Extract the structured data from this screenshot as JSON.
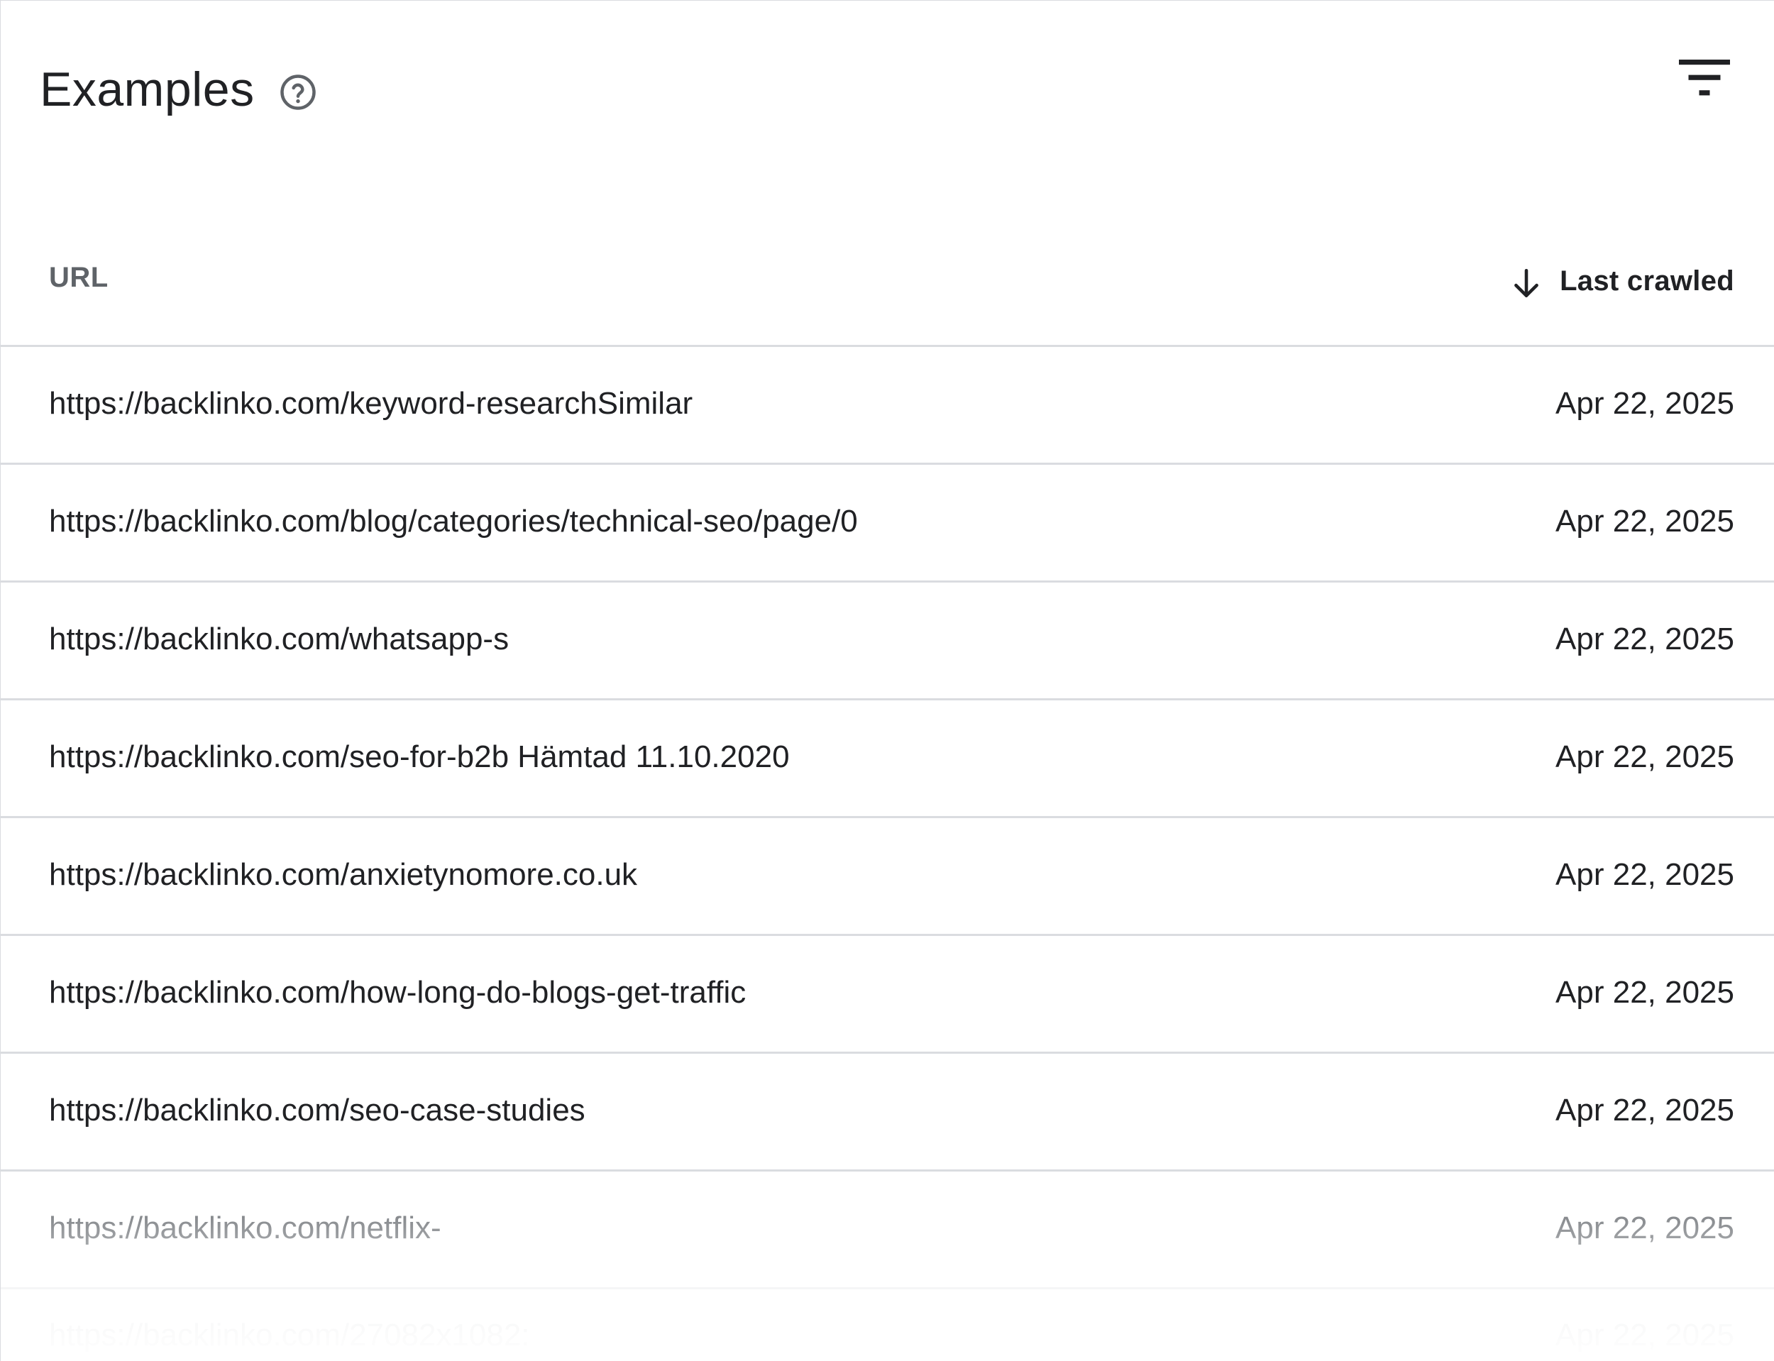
{
  "header": {
    "title": "Examples",
    "help_icon": "help-circle-icon",
    "filter_icon": "filter-icon"
  },
  "table": {
    "columns": {
      "url": "URL",
      "last_crawled": "Last crawled",
      "sort_icon": "arrow-down-icon"
    },
    "rows": [
      {
        "url": "https://backlinko.com/keyword-researchSimilar",
        "date": "Apr 22, 2025"
      },
      {
        "url": "https://backlinko.com/blog/categories/technical-seo/page/0",
        "date": "Apr 22, 2025"
      },
      {
        "url": "https://backlinko.com/whatsapp-s",
        "date": "Apr 22, 2025"
      },
      {
        "url": "https://backlinko.com/seo-for-b2b Hämtad 11.10.2020",
        "date": "Apr 22, 2025"
      },
      {
        "url": "https://backlinko.com/anxietynomore.co.uk",
        "date": "Apr 22, 2025"
      },
      {
        "url": "https://backlinko.com/how-long-do-blogs-get-traffic",
        "date": "Apr 22, 2025"
      },
      {
        "url": "https://backlinko.com/seo-case-studies",
        "date": "Apr 22, 2025"
      },
      {
        "url": "https://backlinko.com/netflix-",
        "date": "Apr 22, 2025"
      },
      {
        "url": "https://backlinko.com/27082x1082:",
        "date": "Apr 22, 2025"
      }
    ]
  },
  "colors": {
    "text_primary": "#202124",
    "text_secondary": "#5f6368",
    "divider": "#dadce0"
  }
}
